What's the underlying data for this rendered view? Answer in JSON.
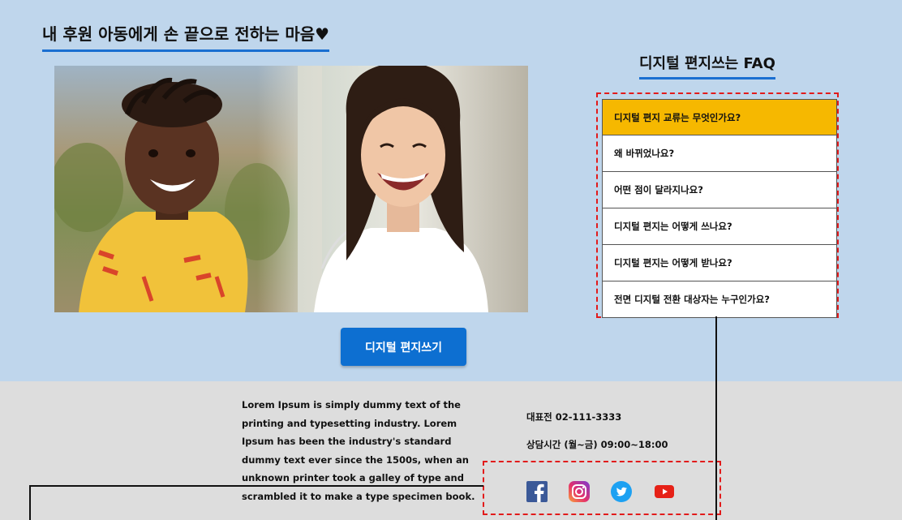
{
  "hero": {
    "title": "내 후원 아동에게 손 끝으로 전하는 마음♥",
    "cta_label": "디지털 편지쓰기"
  },
  "faq": {
    "title": "디지털 편지쓰는 FAQ",
    "items": [
      "디지털 편지 교류는 무엇인가요?",
      "왜 바뀌었나요?",
      "어떤 점이 달라지나요?",
      "디지털 편지는 어떻게 쓰나요?",
      "디지털 편지는 어떻게 받나요?",
      "전면 디지털 전환 대상자는 누구인가요?"
    ],
    "active_index": 0
  },
  "footer": {
    "lorem": "Lorem Ipsum is simply dummy text of the printing and typesetting industry. Lorem Ipsum has been the industry's standard dummy text ever since the 1500s, when an unknown printer took a galley of type and scrambled it to make a type specimen book.",
    "phone": "대표전 02-111-3333",
    "hours": "상담시간 (월~금) 09:00~18:00"
  },
  "social": [
    "facebook-icon",
    "instagram-icon",
    "twitter-icon",
    "youtube-icon"
  ],
  "colors": {
    "hero_bg": "#bfd6ec",
    "footer_bg": "#dddddd",
    "accent": "#0d6fd1",
    "faq_active": "#f6b800",
    "annotation": "#e21b1b"
  }
}
